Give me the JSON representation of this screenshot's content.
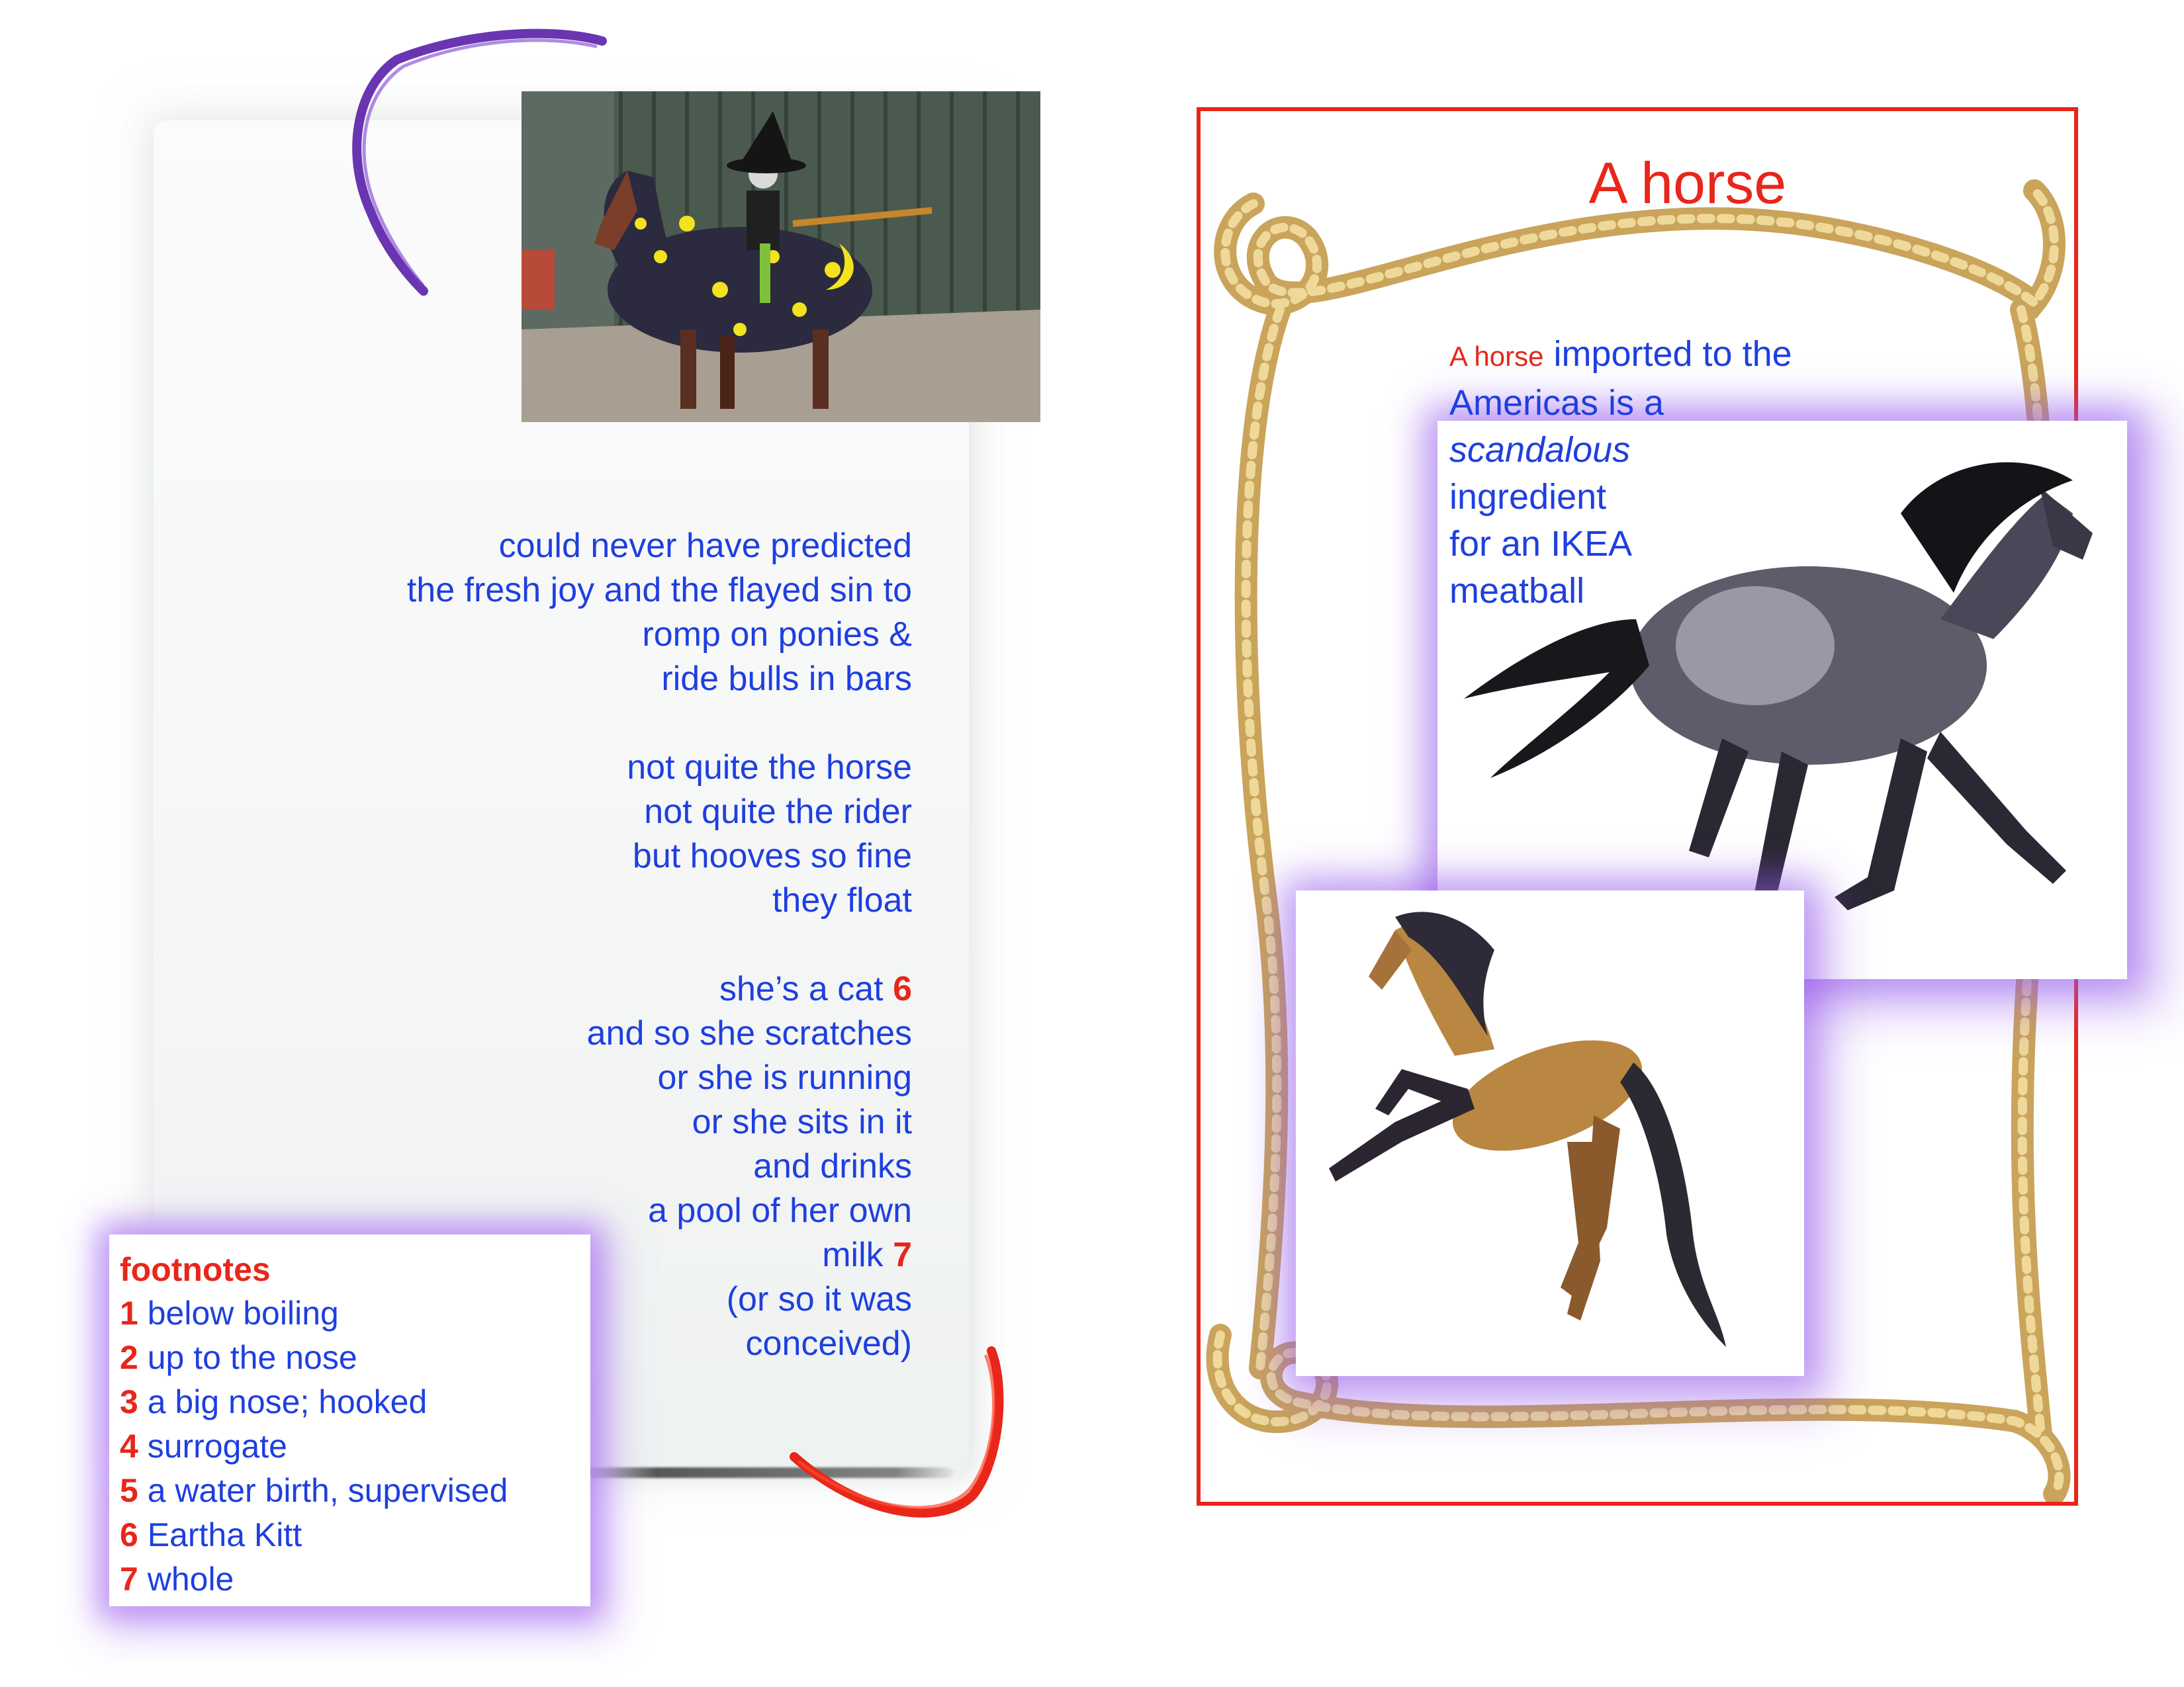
{
  "poem": {
    "stanza1": [
      "could never have predicted",
      "the fresh joy and the flayed sin to",
      "romp on ponies &",
      "ride bulls in bars"
    ],
    "stanza2": [
      "not quite the horse",
      "not quite the rider",
      "but hooves so fine",
      "they float"
    ],
    "stanza3": {
      "line1_text": "she’s a cat",
      "line1_ref": "6",
      "lines_middle": [
        "and so she scratches",
        "or she is running",
        "or she sits in it",
        "and drinks",
        "a pool of her own"
      ],
      "line_milk_text": "milk",
      "line_milk_ref": "7",
      "lines_end": [
        "(or so it was",
        "conceived)"
      ]
    }
  },
  "footnotes": {
    "title": "footnotes",
    "items": [
      {
        "num": "1",
        "text": "below boiling"
      },
      {
        "num": "2",
        "text": "up to the nose"
      },
      {
        "num": "3",
        "text": "a big nose; hooked"
      },
      {
        "num": "4",
        "text": "surrogate"
      },
      {
        "num": "5",
        "text": "a water birth, supervised"
      },
      {
        "num": "6",
        "text": "Eartha Kitt"
      },
      {
        "num": "7",
        "text": "whole"
      }
    ]
  },
  "horse_card": {
    "title": "A horse",
    "text_small_red": "A horse",
    "text_rest1": "imported to the",
    "text_line2": "Americas is a",
    "text_italic": "scandalous",
    "text_line4": "ingredient",
    "text_line5": "for an IKEA",
    "text_line6": "meatball"
  },
  "colors": {
    "poem_blue": "#1e3fe0",
    "accent_red": "#e8261a",
    "glow_purple": "#9a5ae8",
    "rope_tan": "#d8b76c"
  },
  "images": {
    "witch_photo": "witch-on-horse-photo",
    "dark_horse": "blue-roan-horse-image",
    "tan_horse": "rearing-buckskin-horse-image"
  }
}
